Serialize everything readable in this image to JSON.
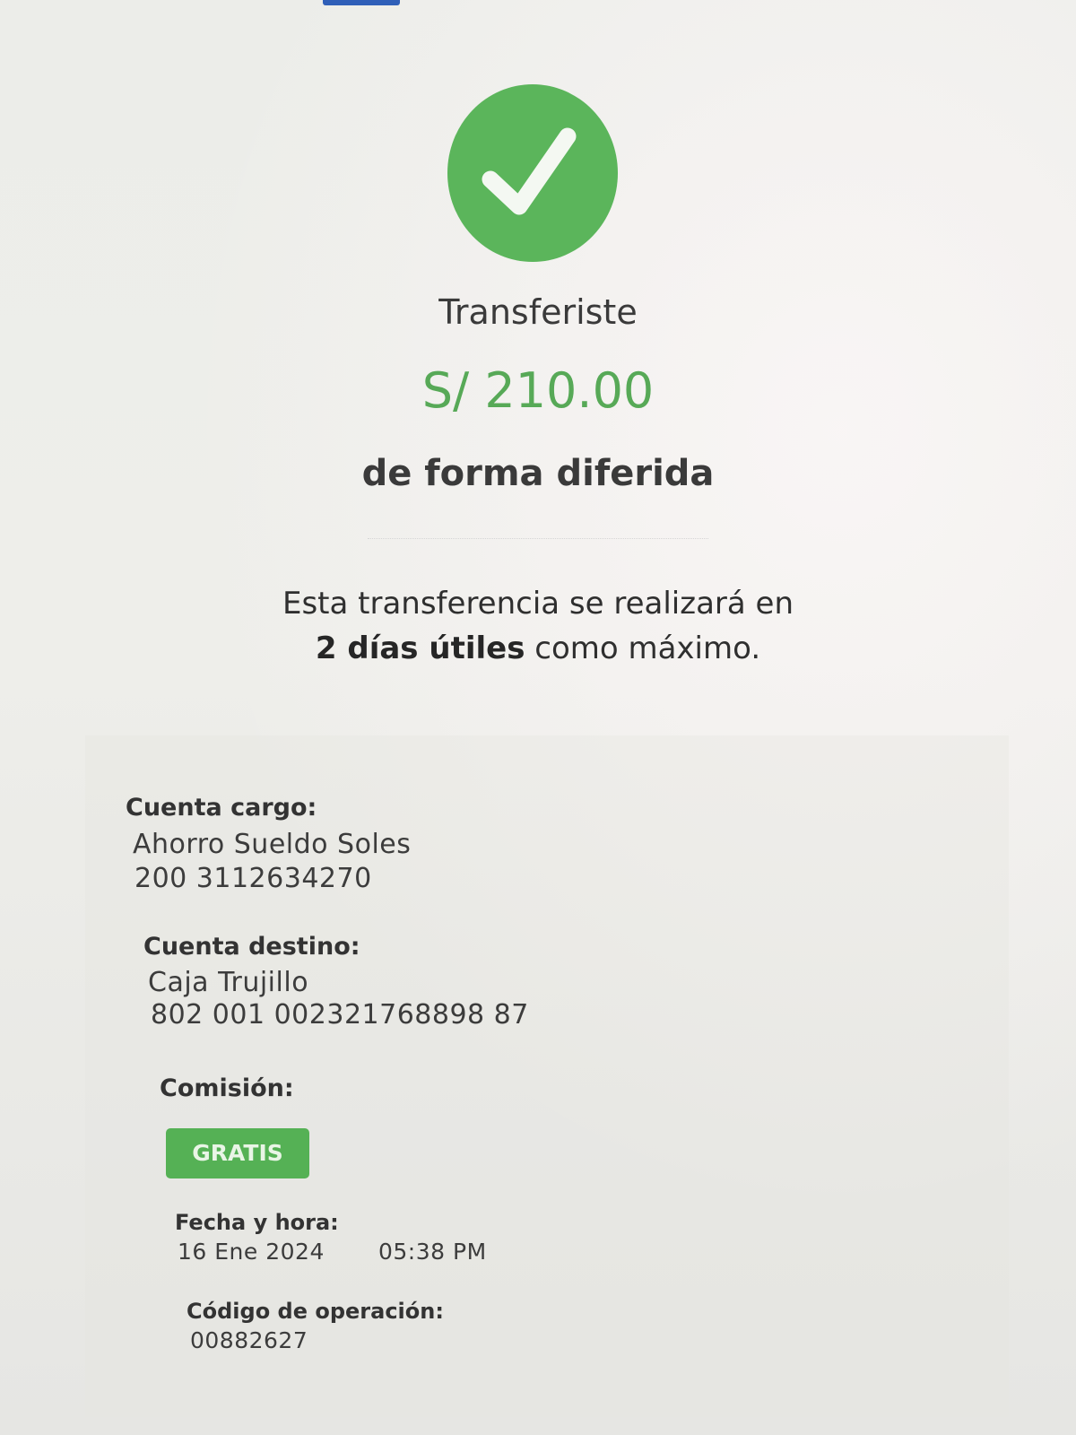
{
  "header": {
    "title": "Transferiste",
    "amount": "S/ 210.00",
    "mode": "de forma diferida"
  },
  "note": {
    "line1": "Esta transferencia se realizará en",
    "line2_bold": "2 días útiles",
    "line2_rest": " como máximo."
  },
  "icons": {
    "status": "check-icon"
  },
  "colors": {
    "success": "#5bb55b",
    "amount": "#57a957",
    "badge": "#55b155"
  },
  "details": {
    "cuenta_cargo": {
      "label": "Cuenta cargo:",
      "name": "Ahorro Sueldo Soles",
      "number": "200 3112634270"
    },
    "cuenta_destino": {
      "label": "Cuenta destino:",
      "name": "Caja Trujillo",
      "number": "802 001 002321768898 87"
    },
    "comision": {
      "label": "Comisión:",
      "badge": "GRATIS"
    },
    "fecha_hora": {
      "label": "Fecha y hora:",
      "date": "16 Ene 2024",
      "time": "05:38 PM"
    },
    "codigo": {
      "label": "Código de operación:",
      "value": "00882627"
    }
  }
}
